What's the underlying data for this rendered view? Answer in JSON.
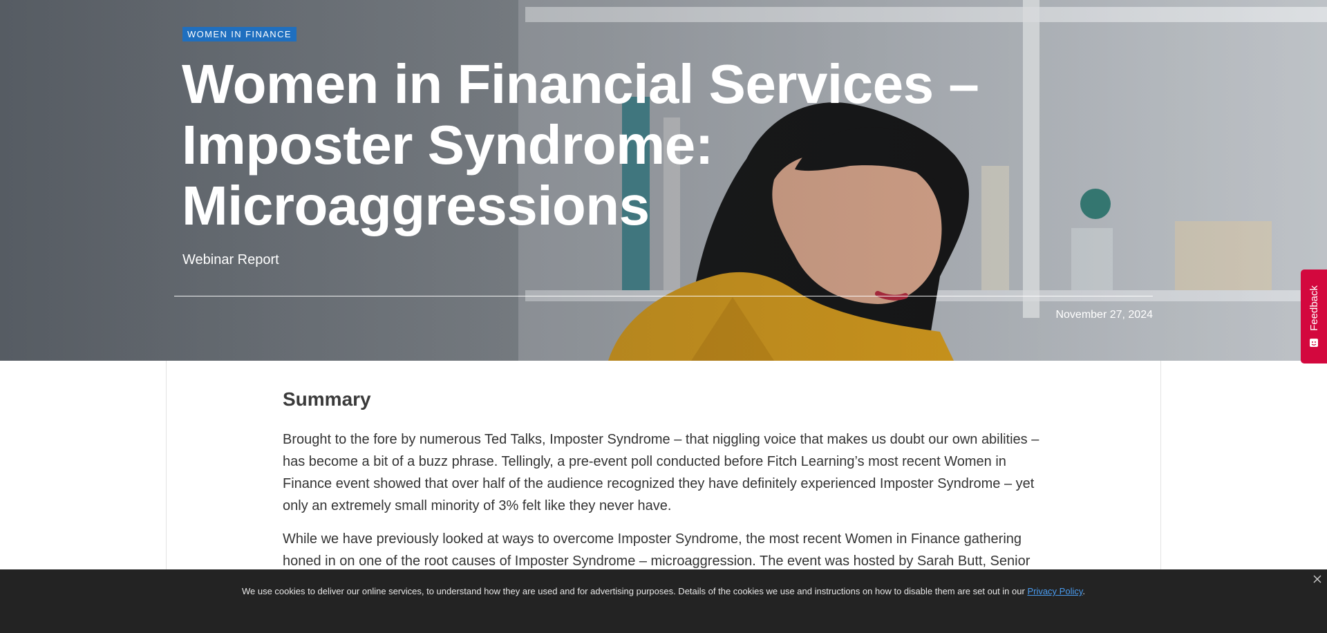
{
  "hero": {
    "tag": "WOMEN IN FINANCE",
    "title": "Women in Financial Services – Imposter Syndrome: Microaggressions",
    "subtitle": "Webinar Report",
    "date": "November 27, 2024"
  },
  "feedback": {
    "label": "Feedback",
    "color": "#d3083e"
  },
  "article": {
    "heading": "Summary",
    "paragraphs": [
      "Brought to the fore by numerous Ted Talks, Imposter Syndrome – that niggling voice that makes us doubt our own abilities – has become a bit of a buzz phrase. Tellingly, a pre-event poll conducted before Fitch Learning’s most recent Women in Finance event showed that over half of the audience recognized they have definitely experienced Imposter Syndrome – yet only an extremely small minority of 3% felt like they never have.",
      "While we have previously looked at ways to overcome Imposter Syndrome, the most recent Women in Finance gathering honed in on one of the root causes of Imposter Syndrome – microaggression. The event was hosted by Sarah Butt, Senior"
    ]
  },
  "cookie_banner": {
    "text": "We use cookies to deliver our online services, to understand how they are used and for advertising purposes. Details of the cookies we use and instructions on how to disable them are set out in our",
    "link_label": "Privacy Policy",
    "end": "."
  },
  "colors": {
    "tag_bg": "#1f6fbf",
    "link": "#4a9cf0",
    "cookie_bg": "#232323"
  }
}
